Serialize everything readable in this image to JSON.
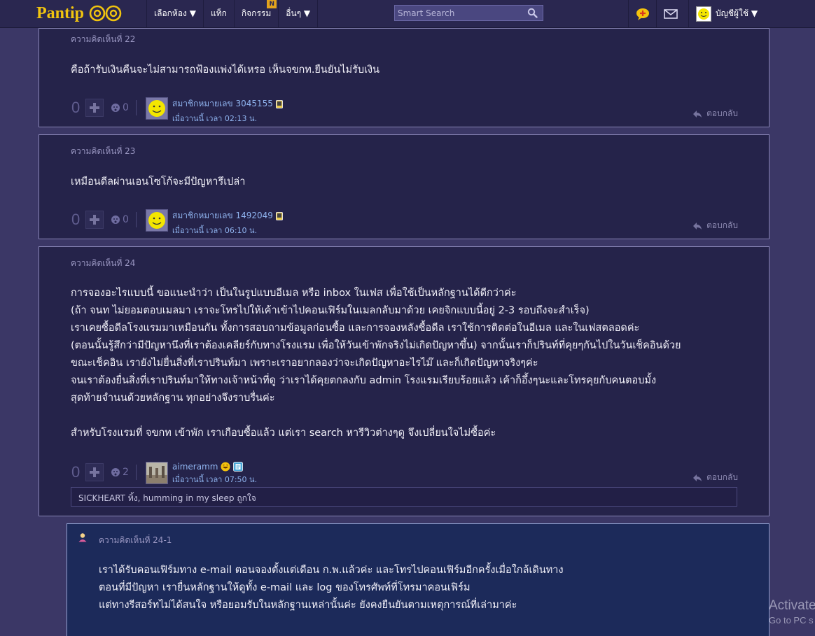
{
  "header": {
    "logo_text": "Pantip",
    "nav": [
      {
        "label": "เลือกห้อง ▼"
      },
      {
        "label": "แท็ก"
      },
      {
        "label": "กิจกรรม",
        "badge": "N"
      },
      {
        "label": "อื่นๆ ▼"
      }
    ],
    "search_placeholder": "Smart Search",
    "account_label": "บัญชีผู้ใช้ ▼"
  },
  "comments": [
    {
      "label": "ความคิดเห็นที่ 22",
      "body": "คือถ้ารับเงินคืนจะไม่สามารถฟ้องแพ่งได้เหรอ เห็นจขกท.ยืนยันไม่รับเงิน",
      "votes": "0",
      "emotions": "0",
      "author": "สมาชิกหมายเลข 3045155",
      "time": "เมื่อวานนี้ เวลา 02:13 น.",
      "reply_label": "ตอบกลับ"
    },
    {
      "label": "ความคิดเห็นที่ 23",
      "body": "เหมือนดีลผ่านเอนโซโก้จะมีปัญหารึเปล่า",
      "votes": "0",
      "emotions": "0",
      "author": "สมาชิกหมายเลข 1492049",
      "time": "เมื่อวานนี้ เวลา 06:10 น.",
      "reply_label": "ตอบกลับ"
    },
    {
      "label": "ความคิดเห็นที่ 24",
      "body": "การจองอะไรแบบนี้ ขอแนะนำว่า เป็นในรูปแบบอีเมล หรือ inbox ในเฟส เพื่อใช้เป็นหลักฐานได้ดีกว่าค่ะ\n(ถ้า จนท ไม่ยอมตอบเมลมา เราจะโทรไปให้เค้าเข้าไปคอนเฟิร์มในเมลกลับมาด้วย เคยจิกแบบนี้อยู่ 2-3 รอบถึงจะสำเร็จ)\nเราเคยซื้อดีลโรงแรมมาเหมือนกัน   ทั้งการสอบถามข้อมูลก่อนซื้อ และการจองหลังซื้อดีล เราใช้การติดต่อในอีเมล และในเฟสตลอดค่ะ\n(ตอนนั้นรู้สึกว่ามีปัญหานึงที่เราต้องเคลียร์กับทางโรงแรม เพื่อให้วันเข้าพักจริงไม่เกิดปัญหาขึ้น) จากนั้นเราก็ปรินท์ที่คุยๆกันไปในวันเช็คอินด้วย\nขณะเช็คอิน เรายังไม่ยื่นสิ่งที่เราปรินท์มา เพราะเราอยากลองว่าจะเกิดปัญหาอะไรไม๊  และก็เกิดปัญหาจริงๆค่ะ\nจนเราต้องยื่นสิ่งที่เราปรินท์มาให้ทางเจ้าหน้าที่ดู  ว่าเราได้คุยตกลงกับ admin โรงแรมเรียบร้อยแล้ว  เค้าก็อึ้งๆนะและโทรคุยกับคนตอบมั้ง\nสุดท้ายจำนนด้วยหลักฐาน ทุกอย่างจึงราบรื่นค่ะ\n\nสำหรับโรงแรมที่ จขกท เข้าพัก เราเกือบซื้อแล้ว แต่เรา search หารีวิวต่างๆดู จึงเปลี่ยนใจไม่ซื้อค่ะ",
      "votes": "0",
      "emotions": "2",
      "author": "aimeramm",
      "time": "เมื่อวานนี้ เวลา 07:50 น.",
      "reply_label": "ตอบกลับ",
      "signature": "SICKHEART ทิ้ง, humming in my sleep ถูกใจ"
    }
  ],
  "reply": {
    "label": "ความคิดเห็นที่ 24-1",
    "body": "เราได้รับคอนเฟิร์มทาง e-mail ตอนจองตั้งแต่เดือน ก.พ.แล้วค่ะ และโทรไปคอนเฟิร์มอีกครั้งเมื่อใกล้เดินทาง\nตอนที่มีปัญหา เรายื่นหลักฐานให้ดูทั้ง e-mail และ log ของโทรศัพท์ที่โทรมาคอนเฟิร์ม\nแต่ทางรีสอร์ทไม่ได้สนใจ หรือยอมรับในหลักฐานเหล่านั้นค่ะ ยังคงยืนยันตามเหตุการณ์ที่เล่ามาค่ะ"
  },
  "watermark": {
    "line1": "Activate",
    "line2": "Go to PC s"
  },
  "colors": {
    "background": "#3b3766",
    "card": "#25234a",
    "reply_card": "#1c2a5a",
    "logo": "#f1c40f",
    "link": "#8fb3ee"
  }
}
